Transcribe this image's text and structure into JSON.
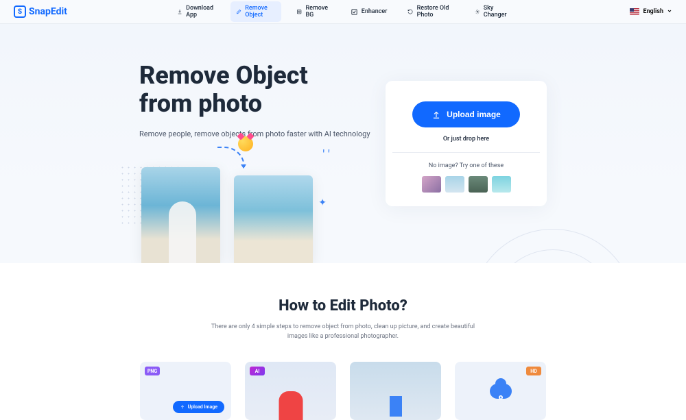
{
  "brand": "SnapEdit",
  "nav": {
    "download": "Download App",
    "remove_object": "Remove Object",
    "remove_bg": "Remove BG",
    "enhancer": "Enhancer",
    "restore": "Restore Old Photo",
    "sky": "Sky Changer"
  },
  "lang": "English",
  "hero": {
    "title_l1": "Remove Object",
    "title_l2": "from photo",
    "subtitle": "Remove people, remove objects from photo faster with AI technology"
  },
  "upload": {
    "button": "Upload image",
    "drop": "Or just drop here",
    "samples_text": "No image? Try one of these"
  },
  "section2": {
    "title": "How to Edit Photo?",
    "desc": "There are only 4 simple steps to remove object from photo, clean up picture, and create beautiful images like a professional photographer."
  },
  "steps": {
    "png": "PNG",
    "ai": "AI",
    "hd": "HD",
    "upload_btn": "Upload Image"
  }
}
